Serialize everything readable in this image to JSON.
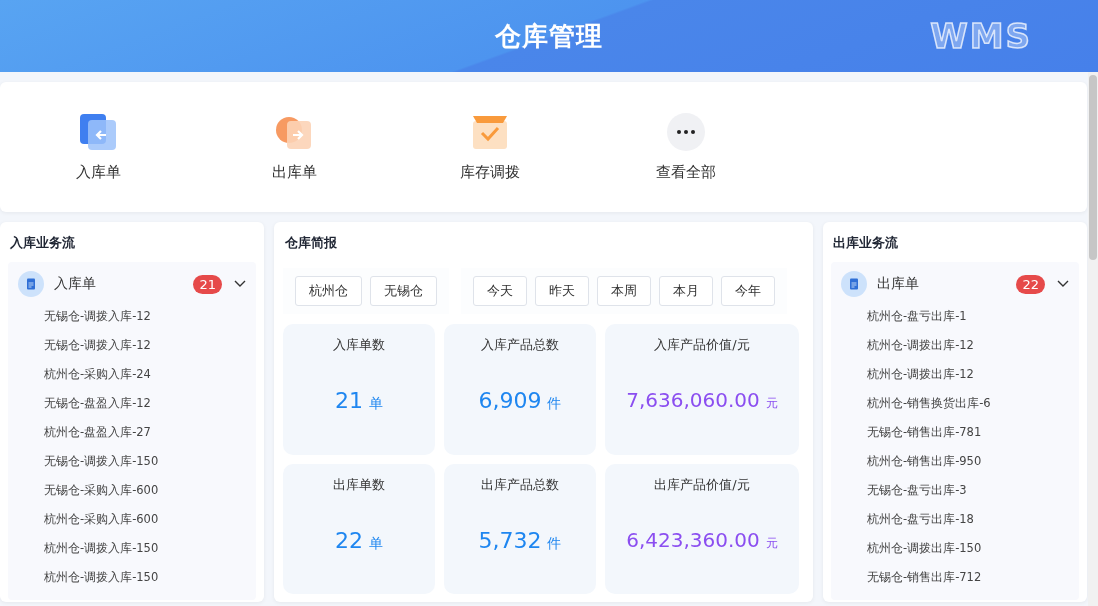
{
  "header": {
    "title": "仓库管理",
    "logo": "WMS"
  },
  "quick_actions": [
    {
      "kind": "inbound",
      "label": "入库单"
    },
    {
      "kind": "outbound",
      "label": "出库单"
    },
    {
      "kind": "transfer",
      "label": "库存调拨"
    },
    {
      "kind": "more",
      "label": "查看全部"
    }
  ],
  "inbound_flow": {
    "title": "入库业务流",
    "group": {
      "label": "入库单",
      "count": "21",
      "expanded": true,
      "items": [
        "无锡仓-调拨入库-12",
        "无锡仓-调拨入库-12",
        "杭州仓-采购入库-24",
        "无锡仓-盘盈入库-12",
        "杭州仓-盘盈入库-27",
        "无锡仓-调拨入库-150",
        "无锡仓-采购入库-600",
        "杭州仓-采购入库-600",
        "杭州仓-调拨入库-150",
        "杭州仓-调拨入库-150"
      ]
    }
  },
  "report": {
    "title": "仓库简报",
    "warehouses": [
      "杭州仓",
      "无锡仓"
    ],
    "periods": [
      "今天",
      "昨天",
      "本周",
      "本月",
      "今年"
    ],
    "stats": [
      {
        "label": "入库单数",
        "value": "21",
        "unit": "单",
        "kind": "count"
      },
      {
        "label": "入库产品总数",
        "value": "6,909",
        "unit": "件",
        "kind": "count"
      },
      {
        "label": "入库产品价值/元",
        "value": "7,636,060.00",
        "unit": "元",
        "kind": "money"
      },
      {
        "label": "出库单数",
        "value": "22",
        "unit": "单",
        "kind": "count"
      },
      {
        "label": "出库产品总数",
        "value": "5,732",
        "unit": "件",
        "kind": "count"
      },
      {
        "label": "出库产品价值/元",
        "value": "6,423,360.00",
        "unit": "元",
        "kind": "money"
      }
    ]
  },
  "outbound_flow": {
    "title": "出库业务流",
    "group": {
      "label": "出库单",
      "count": "22",
      "expanded": true,
      "items": [
        "杭州仓-盘亏出库-1",
        "杭州仓-调拨出库-12",
        "杭州仓-调拨出库-12",
        "杭州仓-销售换货出库-6",
        "无锡仓-销售出库-781",
        "杭州仓-销售出库-950",
        "无锡仓-盘亏出库-3",
        "杭州仓-盘亏出库-18",
        "杭州仓-调拨出库-150",
        "无锡仓-销售出库-712"
      ]
    }
  }
}
